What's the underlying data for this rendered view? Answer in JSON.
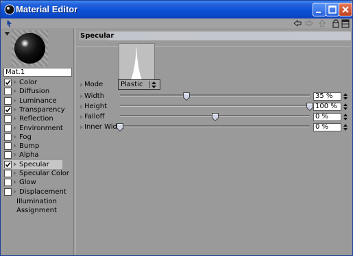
{
  "window": {
    "title": "Material Editor",
    "title_bar_color": "#0b50d6",
    "controls": [
      "minimize-icon",
      "maximize-icon",
      "close-icon"
    ]
  },
  "toolbar": {
    "icons": [
      "arrow-left-icon",
      "arrow-right-icon",
      "arrow-up-icon",
      "lock-icon",
      "layout-icon"
    ]
  },
  "material": {
    "name": "Mat.1"
  },
  "channels": [
    {
      "label": "Color",
      "checked": true
    },
    {
      "label": "Diffusion",
      "checked": false
    },
    {
      "label": "Luminance",
      "checked": false
    },
    {
      "label": "Transparency",
      "checked": true
    },
    {
      "label": "Reflection",
      "checked": false
    },
    {
      "label": "Environment",
      "checked": false
    },
    {
      "label": "Fog",
      "checked": false
    },
    {
      "label": "Bump",
      "checked": false
    },
    {
      "label": "Alpha",
      "checked": false
    },
    {
      "label": "Specular",
      "checked": true,
      "selected": true
    },
    {
      "label": "Specular Color",
      "checked": false
    },
    {
      "label": "Glow",
      "checked": false
    },
    {
      "label": "Displacement",
      "checked": false
    }
  ],
  "extra_items": [
    "Illumination",
    "Assignment"
  ],
  "section": {
    "title": "Specular"
  },
  "params": {
    "mode": {
      "label": "Mode",
      "value": "Plastic"
    },
    "width": {
      "label": "Width",
      "value": "35 %",
      "level": 0.35
    },
    "height": {
      "label": "Height",
      "value": "100 %",
      "level": 1.0
    },
    "falloff": {
      "label": "Falloff",
      "value": "0 %",
      "level": 0.5
    },
    "inner_width": {
      "label": "Inner Width",
      "value": "0 %",
      "level": 0.0
    }
  },
  "colors": {
    "panel_bg": "#9a9a9a",
    "selected_row": "#c6c6c6"
  }
}
